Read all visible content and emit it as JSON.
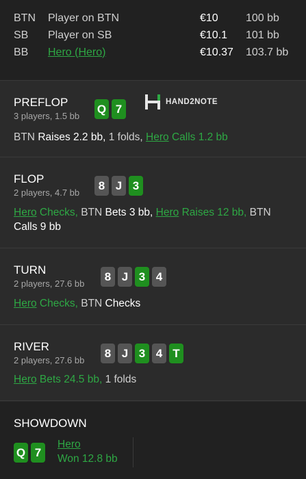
{
  "players": [
    {
      "pos": "BTN",
      "name": "Player on BTN",
      "stack": "€10",
      "bb": "100 bb"
    },
    {
      "pos": "SB",
      "name": "Player on SB",
      "stack": "€10.1",
      "bb": "101 bb"
    },
    {
      "pos": "BB",
      "name": "Hero (Hero)",
      "stack": "€10.37",
      "bb": "103.7 bb"
    }
  ],
  "logo": {
    "text": "HAND2NOTE"
  },
  "preflop": {
    "title": "PREFLOP",
    "sub": "3 players, 1.5 bb",
    "cards": [
      "Q",
      "7"
    ],
    "a1": "BTN",
    "a2": "Raises 2.2 bb,",
    "a3": "1 folds,",
    "a4": "Hero",
    "a5": "Calls 1.2 bb"
  },
  "flop": {
    "title": "FLOP",
    "sub": "2 players, 4.7 bb",
    "cards": [
      "8",
      "J",
      "3"
    ],
    "a1": "Hero",
    "a2": "Checks,",
    "a3": "BTN",
    "a4": "Bets 3 bb,",
    "a5": "Hero",
    "a6": "Raises 12 bb,",
    "a7": "BTN",
    "a8": "Calls",
    "a9": "9 bb"
  },
  "turn": {
    "title": "TURN",
    "sub": "2 players, 27.6 bb",
    "cards": [
      "8",
      "J",
      "3",
      "4"
    ],
    "a1": "Hero",
    "a2": "Checks,",
    "a3": "BTN",
    "a4": "Checks"
  },
  "river": {
    "title": "RIVER",
    "sub": "2 players, 27.6 bb",
    "cards": [
      "8",
      "J",
      "3",
      "4",
      "T"
    ],
    "a1": "Hero",
    "a2": "Bets 24.5 bb,",
    "a3": "1 folds"
  },
  "showdown": {
    "title": "SHOWDOWN",
    "cards": [
      "Q",
      "7"
    ],
    "name": "Hero",
    "result": "Won 12.8 bb"
  },
  "colors": {
    "accent": "#2ea844",
    "card_green": "#1f8f1f",
    "card_gray": "#555555"
  }
}
